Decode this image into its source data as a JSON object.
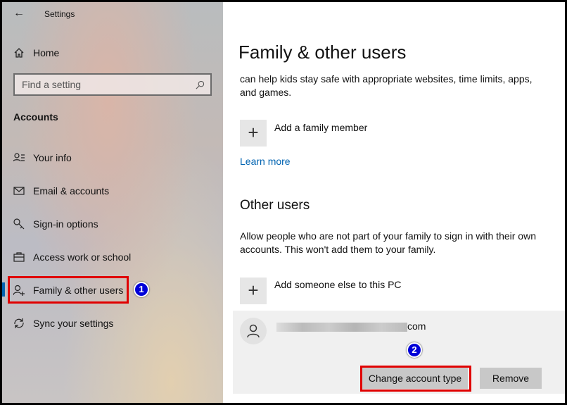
{
  "window": {
    "title": "Settings"
  },
  "sidebar": {
    "home": "Home",
    "search_placeholder": "Find a setting",
    "section": "Accounts",
    "items": [
      {
        "label": "Your info",
        "icon": "person-list-icon"
      },
      {
        "label": "Email & accounts",
        "icon": "mail-icon"
      },
      {
        "label": "Sign-in options",
        "icon": "key-icon"
      },
      {
        "label": "Access work or school",
        "icon": "briefcase-icon"
      },
      {
        "label": "Family & other users",
        "icon": "person-add-icon",
        "selected": true
      },
      {
        "label": "Sync your settings",
        "icon": "sync-icon"
      }
    ]
  },
  "annotations": {
    "badge1": "1",
    "badge2": "2",
    "highlight_color": "#e00000",
    "badge_color": "#0000d8"
  },
  "main": {
    "title": "Family & other users",
    "family_text": "can help kids stay safe with appropriate websites, time limits, apps, and games.",
    "add_family": "Add a family member",
    "learn_more": "Learn more",
    "other_heading": "Other users",
    "other_text": "Allow people who are not part of your family to sign in with their own accounts. This won't add them to your family.",
    "add_someone": "Add someone else to this PC",
    "user_email_suffix": "com",
    "change_button": "Change account type",
    "remove_button": "Remove",
    "accent": "#0063b1"
  }
}
